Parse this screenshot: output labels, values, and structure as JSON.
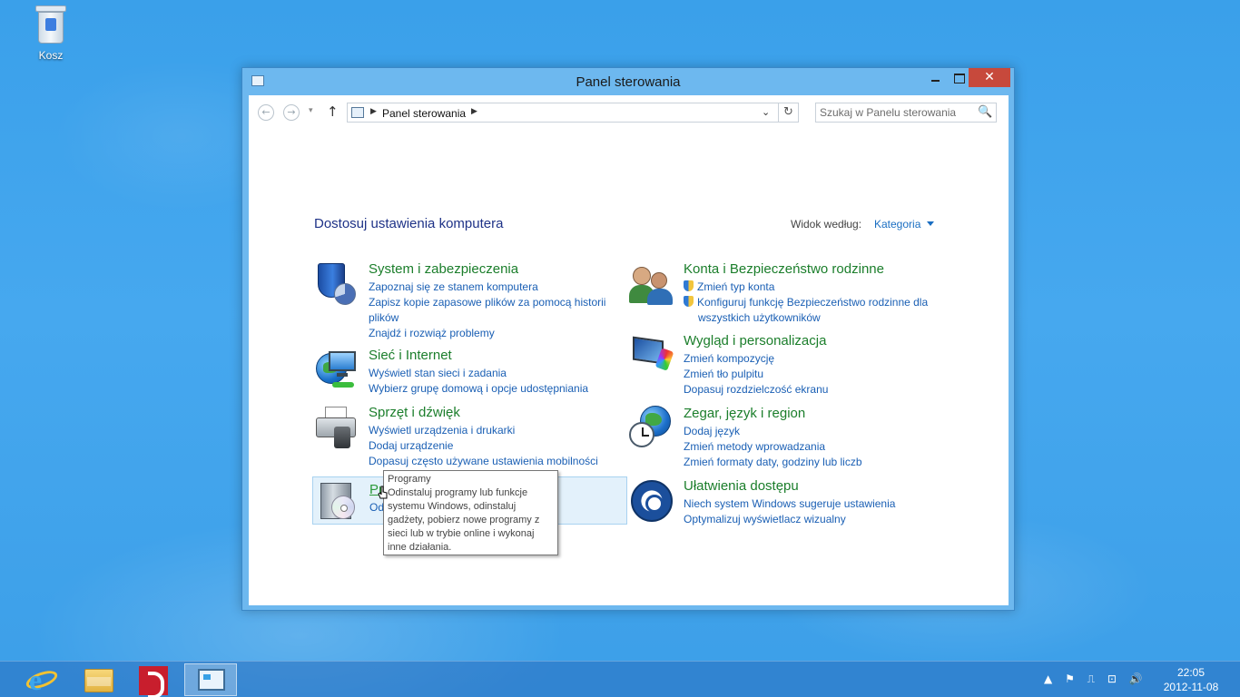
{
  "desktop": {
    "icons": [
      {
        "label": "Kosz",
        "icon": "recycle-bin-icon"
      }
    ]
  },
  "window": {
    "title": "Panel sterowania",
    "controls": {
      "minimize": "minimize-icon",
      "maximize": "maximize-icon",
      "close": "✕"
    }
  },
  "navbar": {
    "back": "←",
    "forward": "→",
    "recent": "▾",
    "up": "↑",
    "breadcrumb": [
      "Panel sterowania"
    ],
    "refresh": "↻",
    "search_placeholder": "Szukaj w Panelu sterowania",
    "search_icon": "🔍"
  },
  "main": {
    "heading": "Dostosuj ustawienia komputera",
    "view_by_label": "Widok według:",
    "view_by_value": "Kategoria"
  },
  "categories": [
    {
      "title": "System i zabezpieczenia",
      "icon": "system-security-icon",
      "links": [
        "Zapoznaj się ze stanem komputera",
        "Zapisz kopie zapasowe plików za pomocą historii plików",
        "Znajdź i rozwiąż problemy"
      ]
    },
    {
      "title": "Sieć i Internet",
      "icon": "network-icon",
      "links": [
        "Wyświetl stan sieci i zadania",
        "Wybierz grupę domową i opcje udostępniania"
      ]
    },
    {
      "title": "Sprzęt i dźwięk",
      "icon": "hardware-sound-icon",
      "links": [
        "Wyświetl urządzenia i drukarki",
        "Dodaj urządzenie",
        "Dopasuj często używane ustawienia mobilności"
      ]
    },
    {
      "title": "Programy",
      "icon": "programs-icon",
      "links": [
        "Odinstaluj program"
      ]
    },
    {
      "title": "Konta i Bezpieczeństwo rodzinne",
      "icon": "user-accounts-icon",
      "links": [
        "Zmień typ konta",
        "Konfiguruj funkcję Bezpieczeństwo rodzinne dla wszystkich użytkowników"
      ]
    },
    {
      "title": "Wygląd i personalizacja",
      "icon": "appearance-icon",
      "links": [
        "Zmień kompozycję",
        "Zmień tło pulpitu",
        "Dopasuj rozdzielczość ekranu"
      ]
    },
    {
      "title": "Zegar, język i region",
      "icon": "clock-region-icon",
      "links": [
        "Dodaj język",
        "Zmień metody wprowadzania",
        "Zmień formaty daty, godziny lub liczb"
      ]
    },
    {
      "title": "Ułatwienia dostępu",
      "icon": "ease-of-access-icon",
      "links": [
        "Niech system Windows sugeruje ustawienia",
        "Optymalizuj wyświetlacz wizualny"
      ]
    }
  ],
  "tooltip": {
    "title": "Programy",
    "text": "Odinstaluj programy lub funkcje systemu Windows, odinstaluj gadżety, pobierz nowe programy z sieci lub w trybie online i wykonaj inne działania."
  },
  "taskbar": {
    "items": [
      "internet-explorer-icon",
      "file-explorer-icon",
      "red-app-icon",
      "control-panel-icon"
    ],
    "tray_icons": [
      "▲",
      "⚑",
      "⎍",
      "⊡",
      "🔊"
    ],
    "time": "22:05",
    "date": "2012-11-08"
  }
}
